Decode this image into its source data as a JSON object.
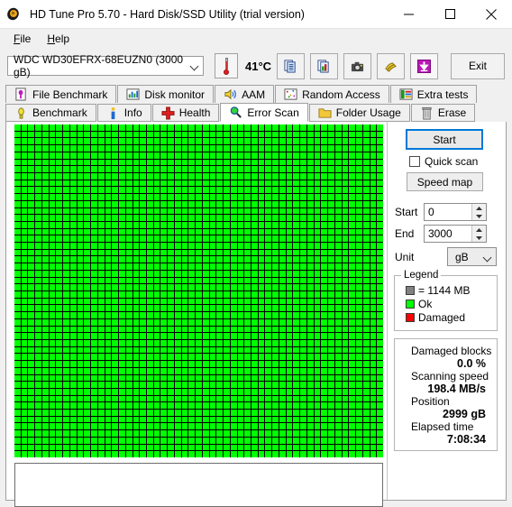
{
  "window": {
    "title": "HD Tune Pro 5.70 - Hard Disk/SSD Utility (trial version)",
    "icon": "hard-disk-platter-icon",
    "minimize_label": "Minimize",
    "maximize_label": "Maximize",
    "close_label": "Close"
  },
  "menu": {
    "items": [
      {
        "label": "File",
        "mnemonic": "F"
      },
      {
        "label": "Help",
        "mnemonic": "H"
      }
    ]
  },
  "toolbar": {
    "drive": "WDC WD30EFRX-68EUZN0 (3000 gB)",
    "temperature": "41°C",
    "thermometer_icon": "thermometer-icon",
    "buttons": [
      {
        "name": "copy-icon",
        "label": "Copy"
      },
      {
        "name": "copy-image-icon",
        "label": "Copy image"
      },
      {
        "name": "screenshot-camera-icon",
        "label": "Screenshot"
      },
      {
        "name": "folder-tools-icon",
        "label": "Options"
      },
      {
        "name": "save-download-icon",
        "label": "Save"
      }
    ],
    "exit_label": "Exit"
  },
  "tabs": {
    "row1": [
      {
        "label": "File Benchmark",
        "icon": "file-benchmark-icon",
        "active": false
      },
      {
        "label": "Disk monitor",
        "icon": "disk-monitor-icon",
        "active": false
      },
      {
        "label": "AAM",
        "icon": "speaker-icon",
        "active": false
      },
      {
        "label": "Random Access",
        "icon": "random-access-icon",
        "active": false
      },
      {
        "label": "Extra tests",
        "icon": "extra-tests-icon",
        "active": false
      }
    ],
    "row2": [
      {
        "label": "Benchmark",
        "icon": "benchmark-icon",
        "active": false
      },
      {
        "label": "Info",
        "icon": "info-icon",
        "active": false
      },
      {
        "label": "Health",
        "icon": "health-cross-icon",
        "active": false
      },
      {
        "label": "Error Scan",
        "icon": "magnifier-icon",
        "active": true
      },
      {
        "label": "Folder Usage",
        "icon": "folder-icon",
        "active": false
      },
      {
        "label": "Erase",
        "icon": "trash-icon",
        "active": false
      }
    ]
  },
  "scan": {
    "start_button": "Start",
    "quick_scan_label": "Quick scan",
    "quick_scan_checked": false,
    "speed_map_button": "Speed map",
    "start_label": "Start",
    "start_value": "0",
    "end_label": "End",
    "end_value": "3000",
    "unit_label": "Unit",
    "unit_value": "gB"
  },
  "legend": {
    "title": "Legend",
    "block_size": "= 1144 MB",
    "ok_label": "Ok",
    "damaged_label": "Damaged",
    "colors": {
      "block": "#808080",
      "ok": "#00ff00",
      "damaged": "#ff0000"
    }
  },
  "stats": [
    {
      "label": "Damaged blocks",
      "value": "0.0 %"
    },
    {
      "label": "Scanning speed",
      "value": "198.4 MB/s"
    },
    {
      "label": "Position",
      "value": "2999 gB"
    },
    {
      "label": "Elapsed time",
      "value": "7:08:34"
    }
  ],
  "map": {
    "columns": 53,
    "rows": 48,
    "ok_color": "#00ff00",
    "grid_color": "#000000",
    "damaged_count": 0
  },
  "log": {
    "text": ""
  }
}
